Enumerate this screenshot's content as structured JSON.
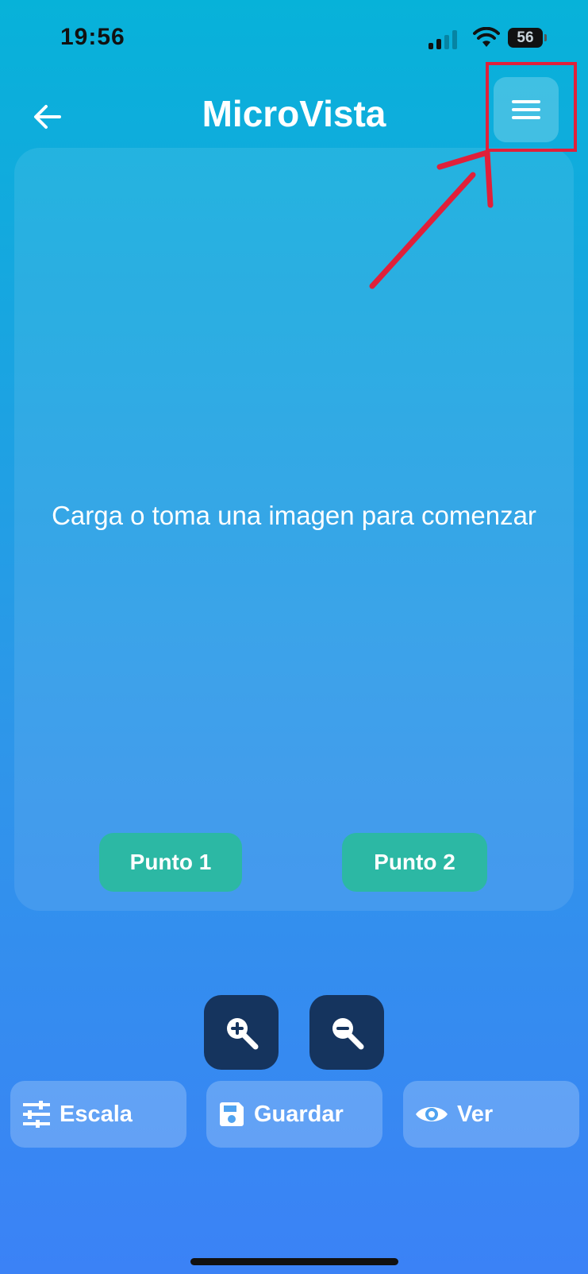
{
  "status_bar": {
    "time": "19:56",
    "battery": "56"
  },
  "header": {
    "title": "MicroVista"
  },
  "icons": {
    "back": "arrow-left-icon",
    "menu": "hamburger-menu-icon",
    "zoom_in": "zoom-in-icon",
    "zoom_out": "zoom-out-icon",
    "escala": "sliders-icon",
    "guardar": "save-icon",
    "ver": "eye-icon"
  },
  "viewer": {
    "prompt": "Carga o toma una imagen para comenzar",
    "point1_label": "Punto 1",
    "point2_label": "Punto 2"
  },
  "toolbar": {
    "escala_label": "Escala",
    "guardar_label": "Guardar",
    "ver_label": "Ver"
  },
  "colors": {
    "point_button": "#2cb8a4",
    "zoom_button": "#15345e",
    "annotation": "#e0203a"
  }
}
